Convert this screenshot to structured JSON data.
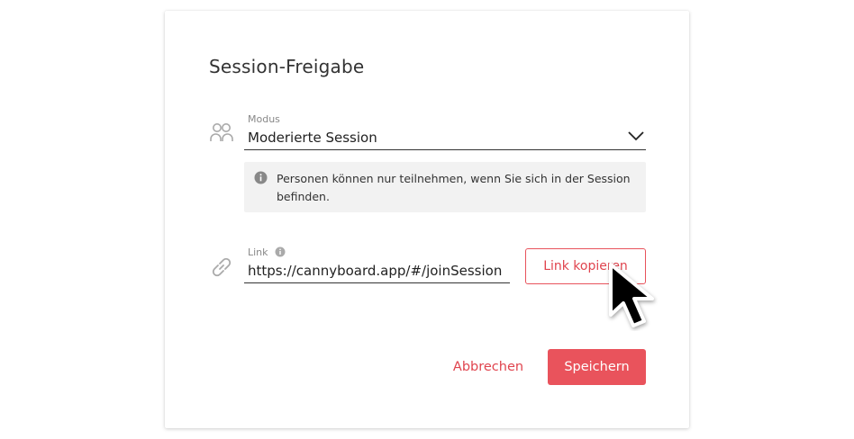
{
  "dialog": {
    "title": "Session-Freigabe"
  },
  "mode": {
    "label": "Modus",
    "selected": "Moderierte Session",
    "icon": "users-icon",
    "info_text": "Personen können nur teilnehmen, wenn Sie sich in der Session befinden."
  },
  "link": {
    "label": "Link",
    "value": "https://cannyboard.app/#/joinSession",
    "icon": "link-icon",
    "copy_label": "Link kopieren"
  },
  "actions": {
    "cancel_label": "Abbrechen",
    "save_label": "Speichern"
  },
  "colors": {
    "accent": "#e9535c",
    "info_bg": "#f2f2f2"
  }
}
